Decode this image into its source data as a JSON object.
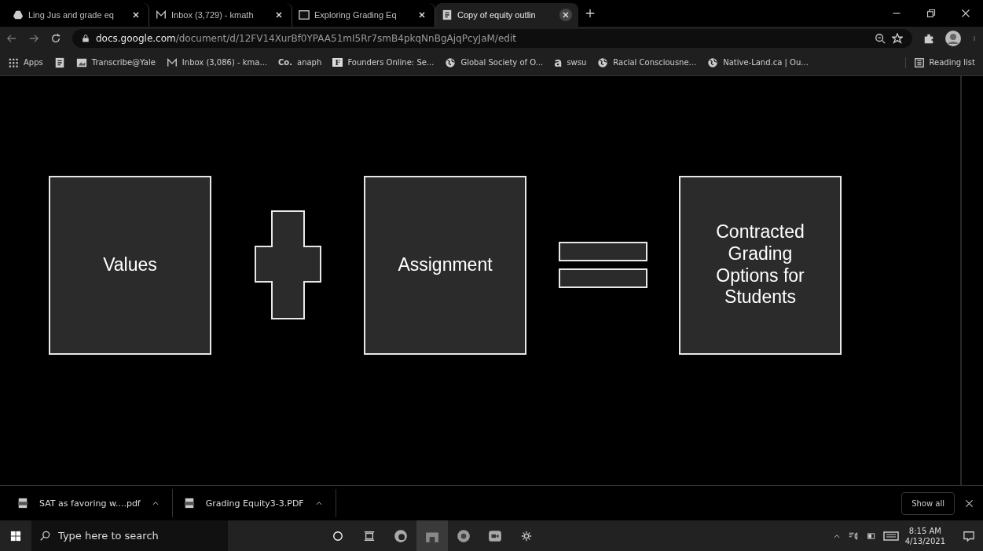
{
  "tabs": [
    {
      "title": "Ling Jus and grade eq",
      "kind": "drive",
      "selected": false
    },
    {
      "title": "Inbox (3,729) - kmath",
      "kind": "mail",
      "selected": false
    },
    {
      "title": "Exploring Grading Eq",
      "kind": "screen",
      "selected": false
    },
    {
      "title": "Copy of equity outlin",
      "kind": "doc",
      "selected": true
    }
  ],
  "address": {
    "host": "docs.google.com",
    "path": "/document/d/12FV14XurBf0YPAA51mI5Rr7smB4pkqNnBgAjqPcyJaM/edit"
  },
  "bookmarks": [
    {
      "label": "Apps",
      "kind": "grid"
    },
    {
      "kind": "doc"
    },
    {
      "label": "Transcribe@Yale",
      "kind": "image"
    },
    {
      "label": "Inbox (3,086) - kma...",
      "kind": "mail"
    },
    {
      "label": "anaph",
      "kind": "letter",
      "icon_text": "Co."
    },
    {
      "label": "Founders Online: Se...",
      "kind": "boxed",
      "icon_text": "F"
    },
    {
      "label": "Global Society of O...",
      "kind": "globe"
    },
    {
      "label": "swsu",
      "kind": "letter",
      "icon_text": "a"
    },
    {
      "label": "Racial Consciousne...",
      "kind": "globe"
    },
    {
      "label": "Native-Land.ca | Ou...",
      "kind": "globe"
    }
  ],
  "reading_list": "Reading list",
  "diagram": [
    {
      "kind": "box",
      "text": "Values"
    },
    {
      "kind": "plus"
    },
    {
      "kind": "box",
      "text": "Assignment"
    },
    {
      "kind": "equals"
    },
    {
      "kind": "box",
      "text": "Contracted Grading Options for Students"
    }
  ],
  "downloads": [
    {
      "name": "SAT as favoring w....pdf"
    },
    {
      "name": "Grading Equity3-3.PDF"
    }
  ],
  "show_all": "Show all",
  "taskbar": {
    "search_placeholder": "Type here to search",
    "time": "8:15 AM",
    "date": "4/13/2021"
  }
}
